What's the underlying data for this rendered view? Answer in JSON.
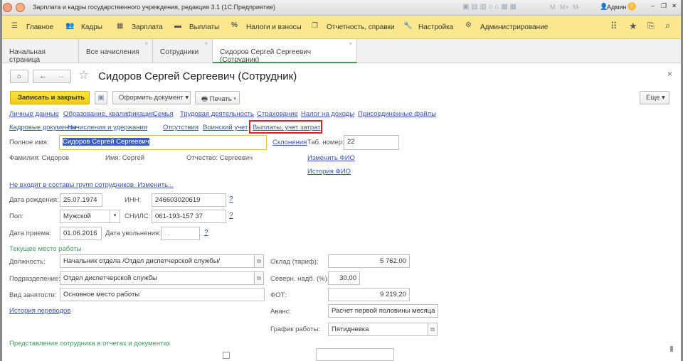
{
  "window": {
    "title": "Зарплата и кадры государственного учреждения, редакция 3.1  (1С:Предприятие)",
    "user": "Админ",
    "memory_buttons": [
      "M",
      "M+",
      "M-"
    ]
  },
  "menu": {
    "items": [
      {
        "label": "Главное",
        "icon": "hamburger-icon"
      },
      {
        "label": "Кадры",
        "icon": "people-icon"
      },
      {
        "label": "Зарплата",
        "icon": "calculator-icon"
      },
      {
        "label": "Выплаты",
        "icon": "card-icon"
      },
      {
        "label": "Налоги и взносы",
        "icon": "percent-icon"
      },
      {
        "label": "Отчетность, справки",
        "icon": "documents-icon"
      },
      {
        "label": "Настройка",
        "icon": "wrench-icon"
      },
      {
        "label": "Администрирование",
        "icon": "gear-icon"
      }
    ]
  },
  "tabs": [
    {
      "label": "Начальная страница"
    },
    {
      "label": "Все начисления"
    },
    {
      "label": "Сотрудники"
    },
    {
      "label": "Сидоров Сергей Сергеевич (Сотрудник)",
      "active": true
    }
  ],
  "form": {
    "title": "Сидоров Сергей Сергеевич (Сотрудник)",
    "toolbar": {
      "save_close": "Записать и закрыть",
      "create_doc": "Оформить документ",
      "print": "Печать",
      "more": "Еще"
    },
    "links_row1": [
      "Личные данные",
      "Образование, квалификация",
      "Семья",
      "Трудовая деятельность",
      "Страхование",
      "Налог на доходы",
      "Присоединенные файлы"
    ],
    "links_row2": [
      "Кадровые документы",
      "Начисления и удержания",
      "Отсутствия",
      "Воинский учет",
      "Выплаты, учет затрат"
    ],
    "full_name_label": "Полное имя:",
    "full_name": "Сидоров Сергей Сергеевич",
    "declensions": "Склонения",
    "tab_no_label": "Таб. номер:",
    "tab_no": "22",
    "surname": "Фамилия: Сидоров",
    "name": "Имя: Сергей",
    "patronymic": "Отчество: Сергеевич",
    "change_fio": "Изменить ФИО",
    "history_fio": "История ФИО",
    "groups_link": "Не входит в составы групп сотрудников. Изменить...",
    "birth_label": "Дата рождения:",
    "birth": "25.07.1974",
    "inn_label": "ИНН:",
    "inn": "246603020619",
    "sex_label": "Пол:",
    "sex": "Мужской",
    "snils_label": "СНИЛС:",
    "snils": "061-193-157 37",
    "hire_label": "Дата приема:",
    "hire": "01.06.2016",
    "dismiss_label": "Дата увольнения:",
    "dismiss": " .  . ",
    "help": "?",
    "current_work": "Текущее место работы",
    "position_label": "Должность:",
    "position": "Начальник отдела /Отдел диспетчерской службы/",
    "salary_label": "Оклад (тариф):",
    "salary": "5 762,00",
    "dept_label": "Подразделение:",
    "dept": "Отдел диспетчерской службы",
    "north_label": "Северн. надб. (%):",
    "north": "30,00",
    "employment_label": "Вид занятости:",
    "employment": "Основное место работы",
    "fot_label": "ФОТ:",
    "fot": "9 219,20",
    "transfers": "История переводов",
    "advance_label": "Аванс:",
    "advance": "Расчет первой половины месяца",
    "schedule_label": "График работы:",
    "schedule": "Пятидневка",
    "representation": "Представление сотрудника в отчетах и документах"
  },
  "colors": {
    "menu_bg": "#fbe88e",
    "primary_button": "#f5d20e",
    "link": "#3b57a8",
    "section": "#3c9d5c",
    "highlight_box": "#e02020"
  }
}
